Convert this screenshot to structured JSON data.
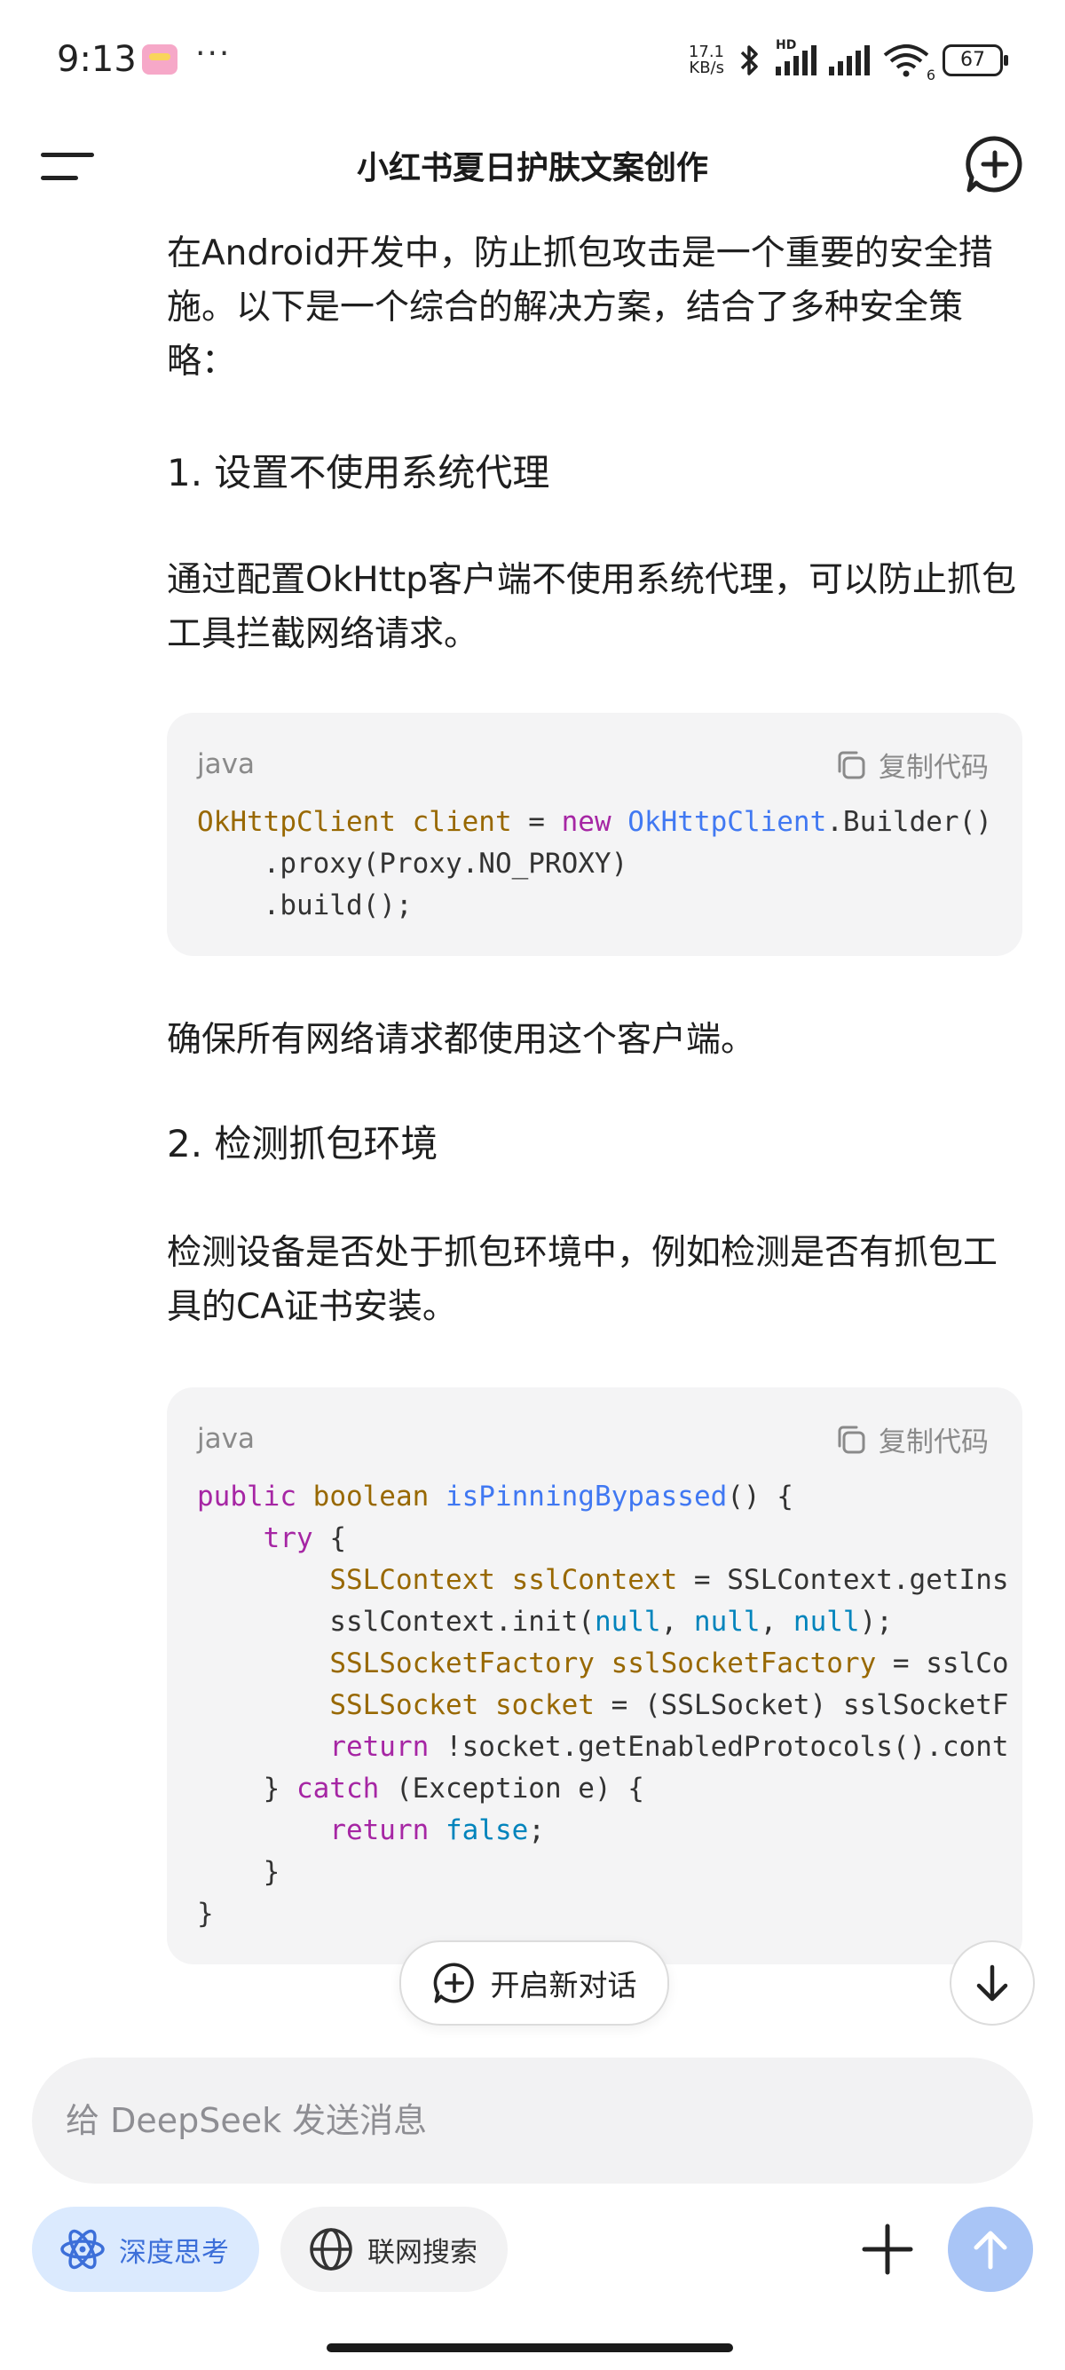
{
  "status_bar": {
    "time": "9:13",
    "dots": "···",
    "net_speed_value": "17.1",
    "net_speed_unit": "KB/s",
    "signal_label": "HD",
    "wifi_sub": "6",
    "battery": "67"
  },
  "header": {
    "title": "小红书夏日护肤文案创作"
  },
  "content": {
    "intro": "在Android开发中，防止抓包攻击是一个重要的安全措施。以下是一个综合的解决方案，结合了多种安全策略：",
    "section1_heading": "1. 设置不使用系统代理",
    "section1_text": "通过配置OkHttp客户端不使用系统代理，可以防止抓包工具拦截网络请求。",
    "code1": {
      "language": "java",
      "copy_label": "复制代码",
      "lines": [
        [
          [
            "t",
            "OkHttpClient"
          ],
          [
            "p",
            " "
          ],
          [
            "t",
            "client"
          ],
          [
            "p",
            " = "
          ],
          [
            "k",
            "new"
          ],
          [
            "p",
            " "
          ],
          [
            "f",
            "OkHttpClient"
          ],
          [
            "p",
            ".Builder()"
          ]
        ],
        [
          [
            "p",
            "    .proxy(Proxy.NO_PROXY)"
          ]
        ],
        [
          [
            "p",
            "    .build();"
          ]
        ]
      ]
    },
    "after_code1": "确保所有网络请求都使用这个客户端。",
    "section2_heading": "2. 检测抓包环境",
    "section2_text": "检测设备是否处于抓包环境中，例如检测是否有抓包工具的CA证书安装。",
    "code2": {
      "language": "java",
      "copy_label": "复制代码",
      "lines": [
        [
          [
            "k",
            "public"
          ],
          [
            "p",
            " "
          ],
          [
            "t",
            "boolean"
          ],
          [
            "p",
            " "
          ],
          [
            "f",
            "isPinningBypassed"
          ],
          [
            "p",
            "() {"
          ]
        ],
        [
          [
            "p",
            "    "
          ],
          [
            "k",
            "try"
          ],
          [
            "p",
            " {"
          ]
        ],
        [
          [
            "p",
            "        "
          ],
          [
            "t",
            "SSLContext"
          ],
          [
            "p",
            " "
          ],
          [
            "t",
            "sslContext"
          ],
          [
            "p",
            " = SSLContext.getIns"
          ]
        ],
        [
          [
            "p",
            "        sslContext.init("
          ],
          [
            "n",
            "null"
          ],
          [
            "p",
            ", "
          ],
          [
            "n",
            "null"
          ],
          [
            "p",
            ", "
          ],
          [
            "n",
            "null"
          ],
          [
            "p",
            ");"
          ]
        ],
        [
          [
            "p",
            "        "
          ],
          [
            "t",
            "SSLSocketFactory"
          ],
          [
            "p",
            " "
          ],
          [
            "t",
            "sslSocketFactory"
          ],
          [
            "p",
            " = sslCo"
          ]
        ],
        [
          [
            "p",
            "        "
          ],
          [
            "t",
            "SSLSocket"
          ],
          [
            "p",
            " "
          ],
          [
            "t",
            "socket"
          ],
          [
            "p",
            " = (SSLSocket) sslSocketF"
          ]
        ],
        [
          [
            "p",
            "        "
          ],
          [
            "k",
            "return"
          ],
          [
            "p",
            " !socket.getEnabledProtocols().cont"
          ]
        ],
        [
          [
            "p",
            "    } "
          ],
          [
            "k",
            "catch"
          ],
          [
            "p",
            " (Exception e) {"
          ]
        ],
        [
          [
            "p",
            "        "
          ],
          [
            "k",
            "return"
          ],
          [
            "p",
            " "
          ],
          [
            "n",
            "false"
          ],
          [
            "p",
            ";"
          ]
        ],
        [
          [
            "p",
            "    }"
          ]
        ],
        [
          [
            "p",
            "}"
          ]
        ]
      ]
    }
  },
  "floating": {
    "new_chat_label": "开启新对话"
  },
  "input": {
    "placeholder": "给 DeepSeek 发送消息"
  },
  "toolbar": {
    "deep_think_label": "深度思考",
    "web_search_label": "联网搜索"
  },
  "colors": {
    "accent": "#3c6fd9",
    "send_button": "#a9c5f6",
    "deep_think_bg": "#dbeafe",
    "code_bg": "#f4f4f5"
  }
}
